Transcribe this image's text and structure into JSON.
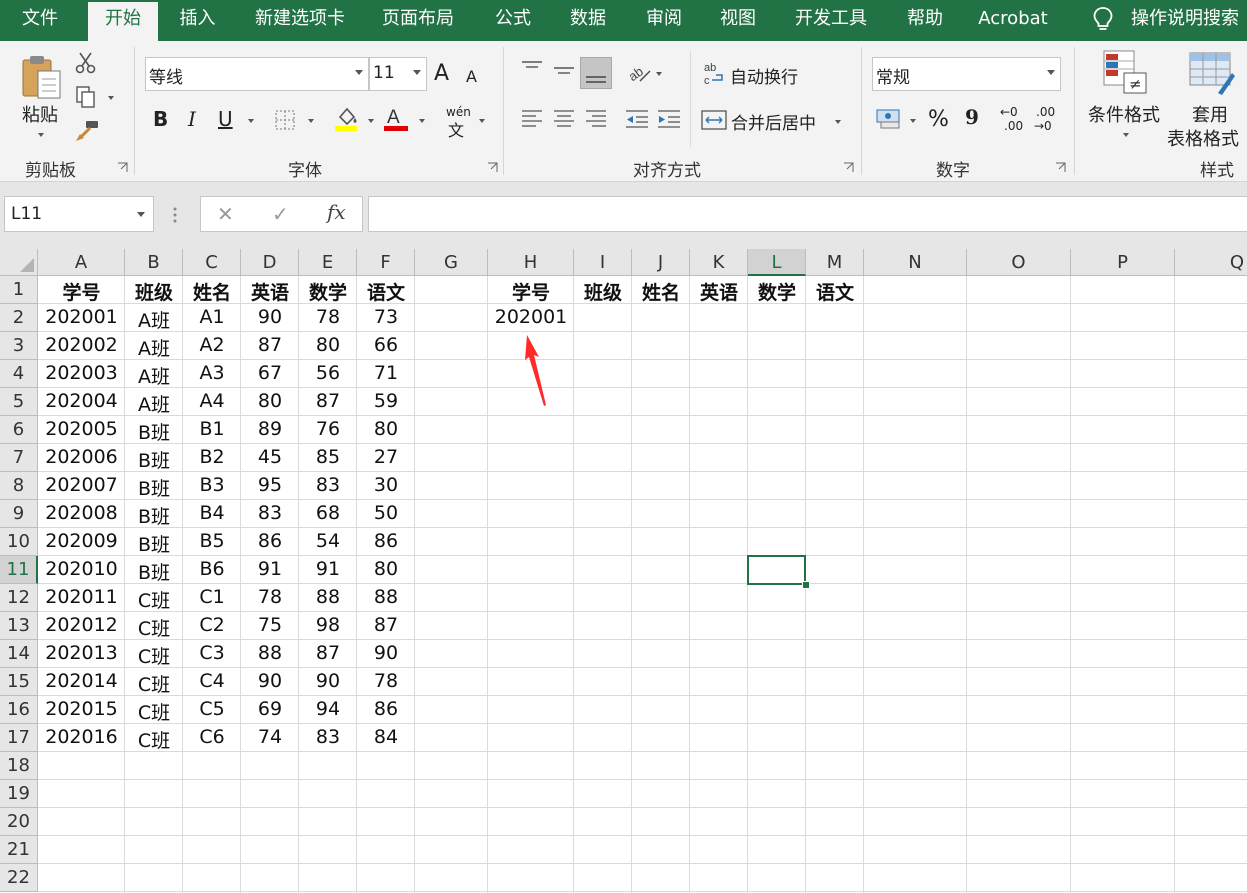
{
  "ribbon_tabs": [
    "文件",
    "开始",
    "插入",
    "新建选项卡",
    "页面布局",
    "公式",
    "数据",
    "审阅",
    "视图",
    "开发工具",
    "帮助",
    "Acrobat"
  ],
  "active_tab": "开始",
  "tell_me": "操作说明搜索",
  "clipboard": {
    "label": "剪贴板",
    "paste": "粘贴"
  },
  "font": {
    "label": "字体",
    "name": "等线",
    "size": "11",
    "bold": "B",
    "italic": "I",
    "underline": "U",
    "grow": "A",
    "shrink": "A",
    "phonetic_top": "wén",
    "phonetic_bottom": "文",
    "highlight_color": "#ffff00",
    "font_color": "#e00000"
  },
  "alignment": {
    "label": "对齐方式",
    "wrap": "自动换行",
    "merge": "合并后居中"
  },
  "number": {
    "label": "数字",
    "format": "常规",
    "percent": "%",
    "comma": "9",
    "inc_decimal_top": "←0",
    "inc_decimal_bottom": ".00",
    "dec_decimal_top": ".00",
    "dec_decimal_bottom": "→0"
  },
  "styles": {
    "label": "样式",
    "conditional": "条件格式",
    "table_top": "套用",
    "table_bottom": "表格格式"
  },
  "formula_bar": {
    "name_box": "L11",
    "cancel": "✕",
    "enter": "✓",
    "fx": "fx",
    "content": ""
  },
  "columns": [
    "A",
    "B",
    "C",
    "D",
    "E",
    "F",
    "G",
    "H",
    "I",
    "J",
    "K",
    "L",
    "M",
    "N",
    "O",
    "P",
    "Q"
  ],
  "selected_column": "L",
  "selected_row": 11,
  "rows": [
    1,
    2,
    3,
    4,
    5,
    6,
    7,
    8,
    9,
    10,
    11,
    12,
    13,
    14,
    15,
    16,
    17,
    18,
    19,
    20,
    21,
    22
  ],
  "table_headers": [
    "学号",
    "班级",
    "姓名",
    "英语",
    "数学",
    "语文"
  ],
  "table_rows": [
    [
      "202001",
      "A班",
      "A1",
      "90",
      "78",
      "73"
    ],
    [
      "202002",
      "A班",
      "A2",
      "87",
      "80",
      "66"
    ],
    [
      "202003",
      "A班",
      "A3",
      "67",
      "56",
      "71"
    ],
    [
      "202004",
      "A班",
      "A4",
      "80",
      "87",
      "59"
    ],
    [
      "202005",
      "B班",
      "B1",
      "89",
      "76",
      "80"
    ],
    [
      "202006",
      "B班",
      "B2",
      "45",
      "85",
      "27"
    ],
    [
      "202007",
      "B班",
      "B3",
      "95",
      "83",
      "30"
    ],
    [
      "202008",
      "B班",
      "B4",
      "83",
      "68",
      "50"
    ],
    [
      "202009",
      "B班",
      "B5",
      "86",
      "54",
      "86"
    ],
    [
      "202010",
      "B班",
      "B6",
      "91",
      "91",
      "80"
    ],
    [
      "202011",
      "C班",
      "C1",
      "78",
      "88",
      "88"
    ],
    [
      "202012",
      "C班",
      "C2",
      "75",
      "98",
      "87"
    ],
    [
      "202013",
      "C班",
      "C3",
      "88",
      "87",
      "90"
    ],
    [
      "202014",
      "C班",
      "C4",
      "90",
      "90",
      "78"
    ],
    [
      "202015",
      "C班",
      "C5",
      "69",
      "94",
      "86"
    ],
    [
      "202016",
      "C班",
      "C6",
      "74",
      "83",
      "84"
    ]
  ],
  "lookup_headers": [
    "学号",
    "班级",
    "姓名",
    "英语",
    "数学",
    "语文"
  ],
  "lookup_value": "202001",
  "annotation_color": "#ff2a2a",
  "accent_color": "#217346"
}
